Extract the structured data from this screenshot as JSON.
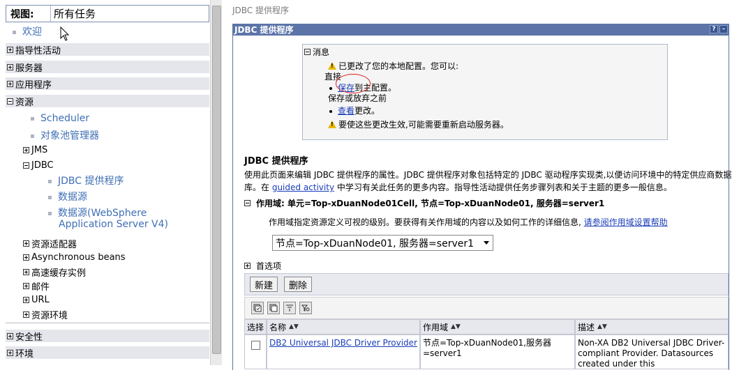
{
  "left_nav": {
    "view_label": "视图:",
    "view_value": "所有任务",
    "welcome": "欢迎",
    "categories": {
      "guided": "指导性活动",
      "servers": "服务器",
      "apps": "应用程序",
      "resources": "资源",
      "security": "安全性",
      "environment": "环境"
    },
    "resource_items": {
      "scheduler": "Scheduler",
      "object_pool": "对象池管理器",
      "jms": "JMS",
      "jdbc": "JDBC",
      "jdbc_provider": "JDBC 提供程序",
      "datasource": "数据源",
      "datasource_v4_line1": "数据源(WebSphere",
      "datasource_v4_line2": "Application Server V4)",
      "adapters": "资源适配器",
      "async_beans": "Asynchronous beans",
      "cache": "高速缓存实例",
      "mail": "邮件",
      "url": "URL",
      "res_env": "资源环境"
    }
  },
  "right": {
    "breadcrumb": "JDBC 提供程序",
    "portlet_title": "JDBC 提供程序",
    "bar_help": "?",
    "bar_min": "-",
    "messages": {
      "header": "消息",
      "changed": "已更改了您的本地配置。您可以:",
      "direct": "直接",
      "save_link": "保存",
      "save_rest": "到主配置。",
      "before_save": "保存或放弃之前",
      "review_link": "查看",
      "review_rest": "更改。",
      "restart": "要使这些更改生效,可能需要重新启动服务器。"
    },
    "section_title": "JDBC 提供程序",
    "desc_part1": "使用此页面来编辑 JDBC 提供程序的属性。JDBC 提供程序对象包括特定的 JDBC 驱动程序实现类,以便访问环境中的特定供应商数据库。在 ",
    "desc_link": "guided activity",
    "desc_part2": " 中学习有关此任务的更多内容。指导性活动提供任务步骤列表和关于主题的更多一般信息。",
    "scope_label": "作用域: 单元=Top-xDuanNode01Cell, 节点=Top-xDuanNode01, 服务器=server1",
    "scope_help_text": "作用域指定资源定义可视的级别。要获得有关作用域的内容以及如何工作的详细信息,",
    "scope_help_link": "请参阅作用域设置帮助",
    "scope_select": "节点=Top-xDuanNode01, 服务器=server1",
    "preferences": "首选项",
    "btn_new": "新建",
    "btn_delete": "删除",
    "table": {
      "headers": [
        "选择",
        "名称",
        "作用域",
        "描述"
      ],
      "row1": {
        "name": "DB2 Universal JDBC Driver Provider",
        "scope": "节点=Top-xDuanNode01,服务器=server1",
        "desc": "Non-XA DB2 Universal JDBC Driver-compliant Provider. Datasources created under this"
      }
    }
  }
}
